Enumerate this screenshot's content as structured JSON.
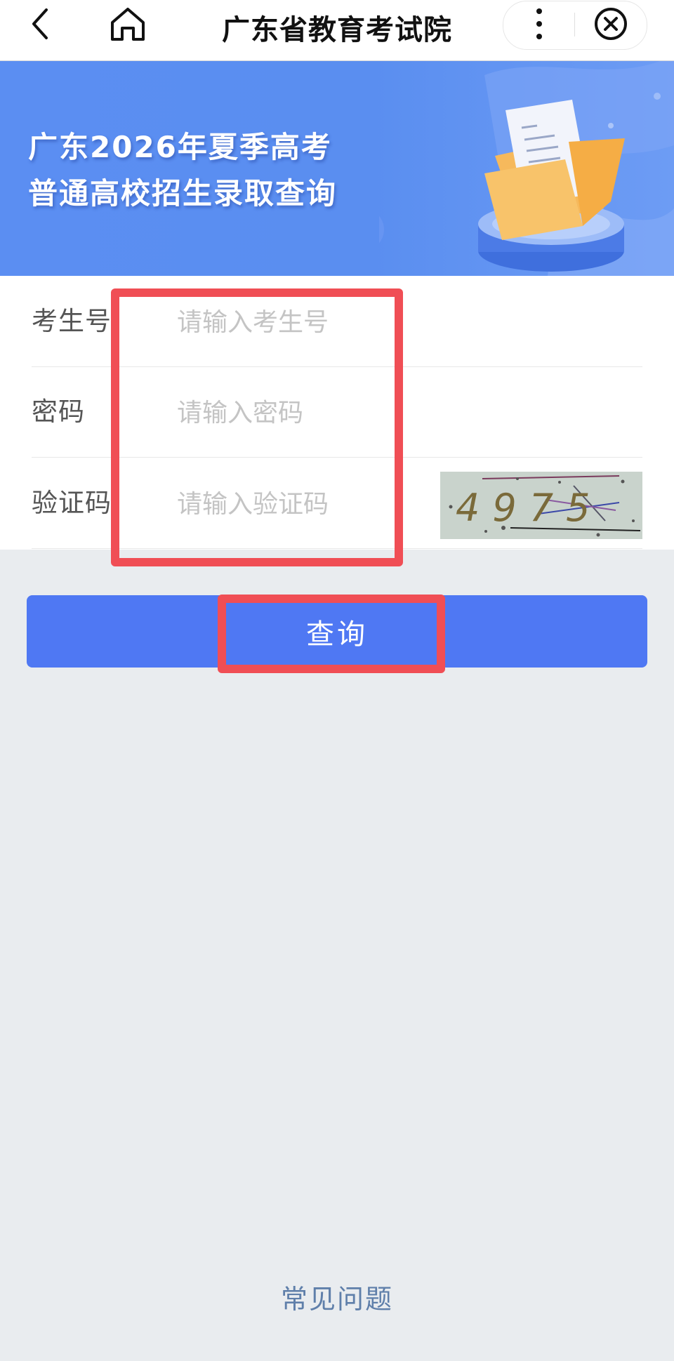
{
  "nav": {
    "title": "广东省教育考试院",
    "back_icon": "chevron-left-icon",
    "home_icon": "home-icon",
    "more_icon": "more-vertical-icon",
    "close_icon": "close-circle-icon"
  },
  "banner": {
    "title_line1": "广东2026年夏季高考",
    "title_line2": "普通高校招生录取查询",
    "illustration_icon": "documents-illustration"
  },
  "form": {
    "fields": [
      {
        "label": "考生号",
        "placeholder": "请输入考生号",
        "value": ""
      },
      {
        "label": "密码",
        "placeholder": "请输入密码",
        "value": ""
      },
      {
        "label": "验证码",
        "placeholder": "请输入验证码",
        "value": ""
      }
    ],
    "captcha_text": "4975"
  },
  "query_button": "查询",
  "faq_link": "常见问题",
  "colors": {
    "primary": "#4f78f3",
    "banner": "#5b8ef2",
    "highlight": "#f04e55",
    "background": "#e9ecef"
  }
}
